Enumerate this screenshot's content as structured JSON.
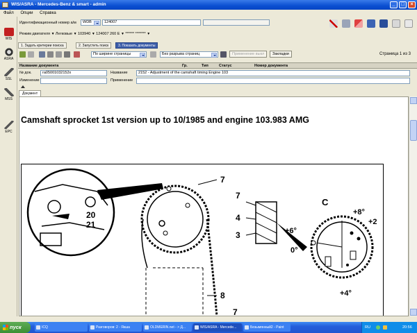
{
  "window": {
    "title": "WIS/ASRA - Mercedes-Benz & smart - admin"
  },
  "menu": [
    "Файл",
    "Опции",
    "Справка"
  ],
  "nav": [
    {
      "label": "WIS",
      "icon": "car-icon",
      "color": "#c22020"
    },
    {
      "label": "ASRA",
      "icon": "wheel-icon",
      "color": "#444444"
    },
    {
      "label": "SSL",
      "icon": "wrench-icon",
      "color": "#555555"
    },
    {
      "label": "MSS",
      "icon": "tools-icon",
      "color": "#555555"
    },
    {
      "label": "EPC",
      "icon": "parts-icon",
      "color": "#555555"
    }
  ],
  "vehicle": {
    "id_label": "Идентификационный номер а/м",
    "prefix_value": "WDB",
    "model_value": "124007",
    "mode_label": "Режим двигателя",
    "mode_value": "Легковые",
    "engine": "103940",
    "model_desc": "124007 260 E",
    "stars": "****** *******"
  },
  "steps": [
    "1. Задать критерии поиска",
    "2. Запустить поиск",
    "3. Показать документы"
  ],
  "toolbar": {
    "fit_option": "По ширине страницы",
    "break_option": "Без разрыва страниц",
    "apply_button": "Применение выкл",
    "bookmarks_button": "Закладки",
    "page_text": "Страница 1 из 3"
  },
  "table": {
    "col_name": "Название документа",
    "col_group": "Гр.",
    "col_type": "Тип",
    "col_status": "Статус",
    "col_number": "Номер документа"
  },
  "meta": {
    "doc_no_label": "№ док.",
    "doc_no_value": "ra05001032152x",
    "name_label": "Название",
    "name_value": "2152 - Adjustment of the camshaft timing Engine 103",
    "change_label": "Изменение",
    "usage_label": "Применение"
  },
  "doc_tab": "Документ",
  "doc": {
    "title": "Camshaft sprocket 1st version up to 10/1985 and engine 103.983 AMG",
    "diagram_labels": {
      "n20": "20",
      "n21": "21",
      "n7a": "7",
      "n7b": "7",
      "n7c": "7",
      "n8": "8",
      "n4": "4",
      "n3": "3",
      "C": "C",
      "p8": "+8°",
      "p2": "+2",
      "p6": "+6°",
      "zero": "0°",
      "p4": "+4°"
    }
  },
  "taskbar": {
    "start": "пуск",
    "tasks": [
      "ICQ",
      "Разговоров: 2 - Якша",
      "OLDMERIN.net - > Д...",
      "WIS/ASRA - Mercede...",
      "Безымянный2 - Paint"
    ],
    "lang": "RU",
    "clock": "20:56"
  },
  "colors": {
    "accent": "#0a4fd1",
    "active_step": "#3b5ca8"
  }
}
